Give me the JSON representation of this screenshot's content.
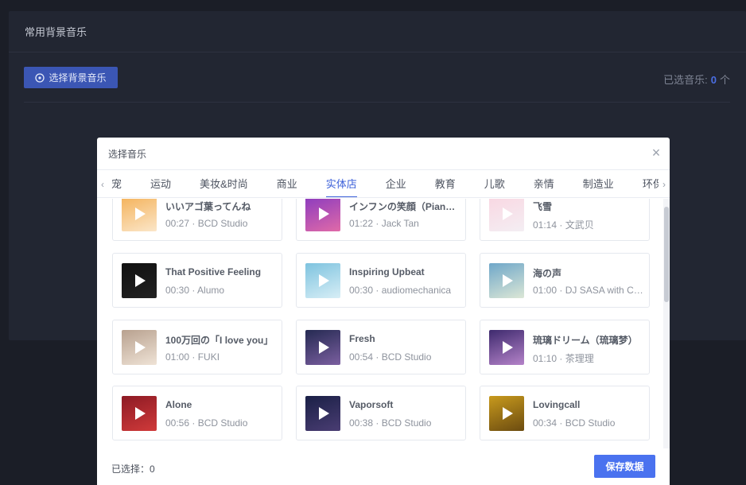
{
  "background": {
    "section_title": "常用背景音乐",
    "select_button": "选择背景音乐",
    "selected_label": "已选音乐:",
    "selected_value": "0",
    "selected_unit": "个"
  },
  "modal": {
    "title": "选择音乐",
    "close": "×",
    "tabs": [
      "宠",
      "运动",
      "美妆&时尚",
      "商业",
      "实体店",
      "企业",
      "教育",
      "儿歌",
      "亲情",
      "制造业",
      "环保"
    ],
    "active_tab": "实体店",
    "tracks": [
      {
        "title": "いいアゴ葉ってんね",
        "duration": "00:27",
        "artist": "BCD Studio",
        "colors": [
          "#f4b25a",
          "#fbe6c9"
        ]
      },
      {
        "title": "インフンの笑顔（Piano）",
        "duration": "01:22",
        "artist": "Jack Tan",
        "colors": [
          "#8b3bbf",
          "#e06aa8"
        ]
      },
      {
        "title": "飞雪",
        "duration": "01:14",
        "artist": "文武贝",
        "colors": [
          "#f9d7e2",
          "#f4eef3"
        ]
      },
      {
        "title": "That Positive Feeling",
        "duration": "00:30",
        "artist": "Alumo",
        "colors": [
          "#111111",
          "#222222"
        ]
      },
      {
        "title": "Inspiring Upbeat",
        "duration": "00:30",
        "artist": "audiomechanica",
        "colors": [
          "#7ec3df",
          "#d7eef6"
        ]
      },
      {
        "title": "海の声",
        "duration": "01:00",
        "artist": "DJ SASA with Cafe",
        "colors": [
          "#6fa7c9",
          "#dce7d6"
        ]
      },
      {
        "title": "100万回の「I love you」",
        "duration": "01:00",
        "artist": "FUKI",
        "colors": [
          "#b8a18f",
          "#efe3d6"
        ]
      },
      {
        "title": "Fresh",
        "duration": "00:54",
        "artist": "BCD Studio",
        "colors": [
          "#252a52",
          "#7b5fa0"
        ]
      },
      {
        "title": "琉璃ドリーム（琉璃梦）",
        "duration": "01:10",
        "artist": "茶理理",
        "colors": [
          "#3e2a6e",
          "#b583c9"
        ]
      },
      {
        "title": "Alone",
        "duration": "00:56",
        "artist": "BCD Studio",
        "colors": [
          "#8d1a24",
          "#d03a3a"
        ]
      },
      {
        "title": "Vaporsoft",
        "duration": "00:38",
        "artist": "BCD Studio",
        "colors": [
          "#1a2046",
          "#4a3d73"
        ]
      },
      {
        "title": "Lovingcall",
        "duration": "00:34",
        "artist": "BCD Studio",
        "colors": [
          "#c89a1d",
          "#6b4b10"
        ]
      }
    ],
    "footer_selected": "已选择：0",
    "save_button": "保存数据"
  }
}
